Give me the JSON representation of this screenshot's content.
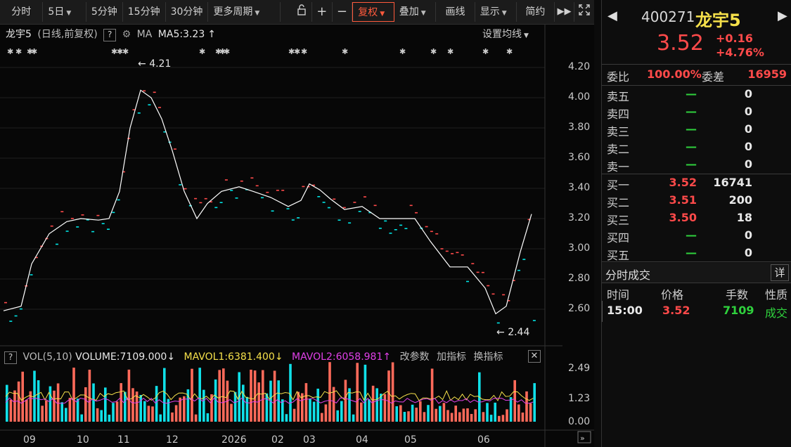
{
  "toolbar": {
    "items": [
      "分时",
      "5日",
      "5分钟",
      "15分钟",
      "30分钟",
      "更多周期",
      "复权",
      "叠加",
      "画线",
      "显示",
      "简约"
    ]
  },
  "info": {
    "name": "龙宇5",
    "params": "(日线,前复权)",
    "ma_label": "MA",
    "ma5": "MA5:3.23",
    "setting": "设置均线"
  },
  "price_axis": [
    "4.20",
    "4.00",
    "3.80",
    "3.60",
    "3.40",
    "3.20",
    "3.00",
    "2.80",
    "2.60"
  ],
  "annotations": {
    "high": "4.21",
    "low": "2.44"
  },
  "volume": {
    "vol_label": "VOL(5,10)",
    "volume": "VOLUME:7109.000",
    "mavol1": "MAVOL1:6381.400",
    "mavol2": "MAVOL2:6058.981",
    "btn1": "改参数",
    "btn2": "加指标",
    "btn3": "换指标",
    "axis": [
      "2.49",
      "1.23",
      "0.00"
    ]
  },
  "x_axis": [
    "09",
    "10",
    "11",
    "12",
    "2026",
    "02",
    "03",
    "04",
    "05",
    "06"
  ],
  "quote": {
    "code": "400271",
    "name": "龙宇5",
    "price": "3.52",
    "change": "+0.16",
    "pct": "+4.76%",
    "ratio_label": "委比",
    "ratio": "100.00%",
    "diff_label": "委差",
    "diff": "16959"
  },
  "orderbook": {
    "asks": [
      {
        "label": "卖五",
        "price": "—",
        "vol": "0"
      },
      {
        "label": "卖四",
        "price": "—",
        "vol": "0"
      },
      {
        "label": "卖三",
        "price": "—",
        "vol": "0"
      },
      {
        "label": "卖二",
        "price": "—",
        "vol": "0"
      },
      {
        "label": "卖一",
        "price": "—",
        "vol": "0"
      }
    ],
    "bids": [
      {
        "label": "买一",
        "price": "3.52",
        "vol": "16741"
      },
      {
        "label": "买二",
        "price": "3.51",
        "vol": "200"
      },
      {
        "label": "买三",
        "price": "3.50",
        "vol": "18"
      },
      {
        "label": "买四",
        "price": "—",
        "vol": "0"
      },
      {
        "label": "买五",
        "price": "—",
        "vol": "0"
      }
    ]
  },
  "trades": {
    "title": "分时成交",
    "detail": "详",
    "headers": [
      "时间",
      "价格",
      "手数",
      "性质"
    ],
    "rows": [
      {
        "time": "15:00",
        "price": "3.52",
        "qty": "7109",
        "nature": "成交"
      }
    ]
  },
  "colors": {
    "up": "#ff4a4a",
    "down": "#00ffff",
    "ma": "#ffffff",
    "accent": "#ff5a3c"
  },
  "chart_data": {
    "type": "candlestick",
    "price_range": [
      2.44,
      4.21
    ],
    "ma5_last": 3.23,
    "volume_range": [
      0,
      2.49
    ]
  }
}
